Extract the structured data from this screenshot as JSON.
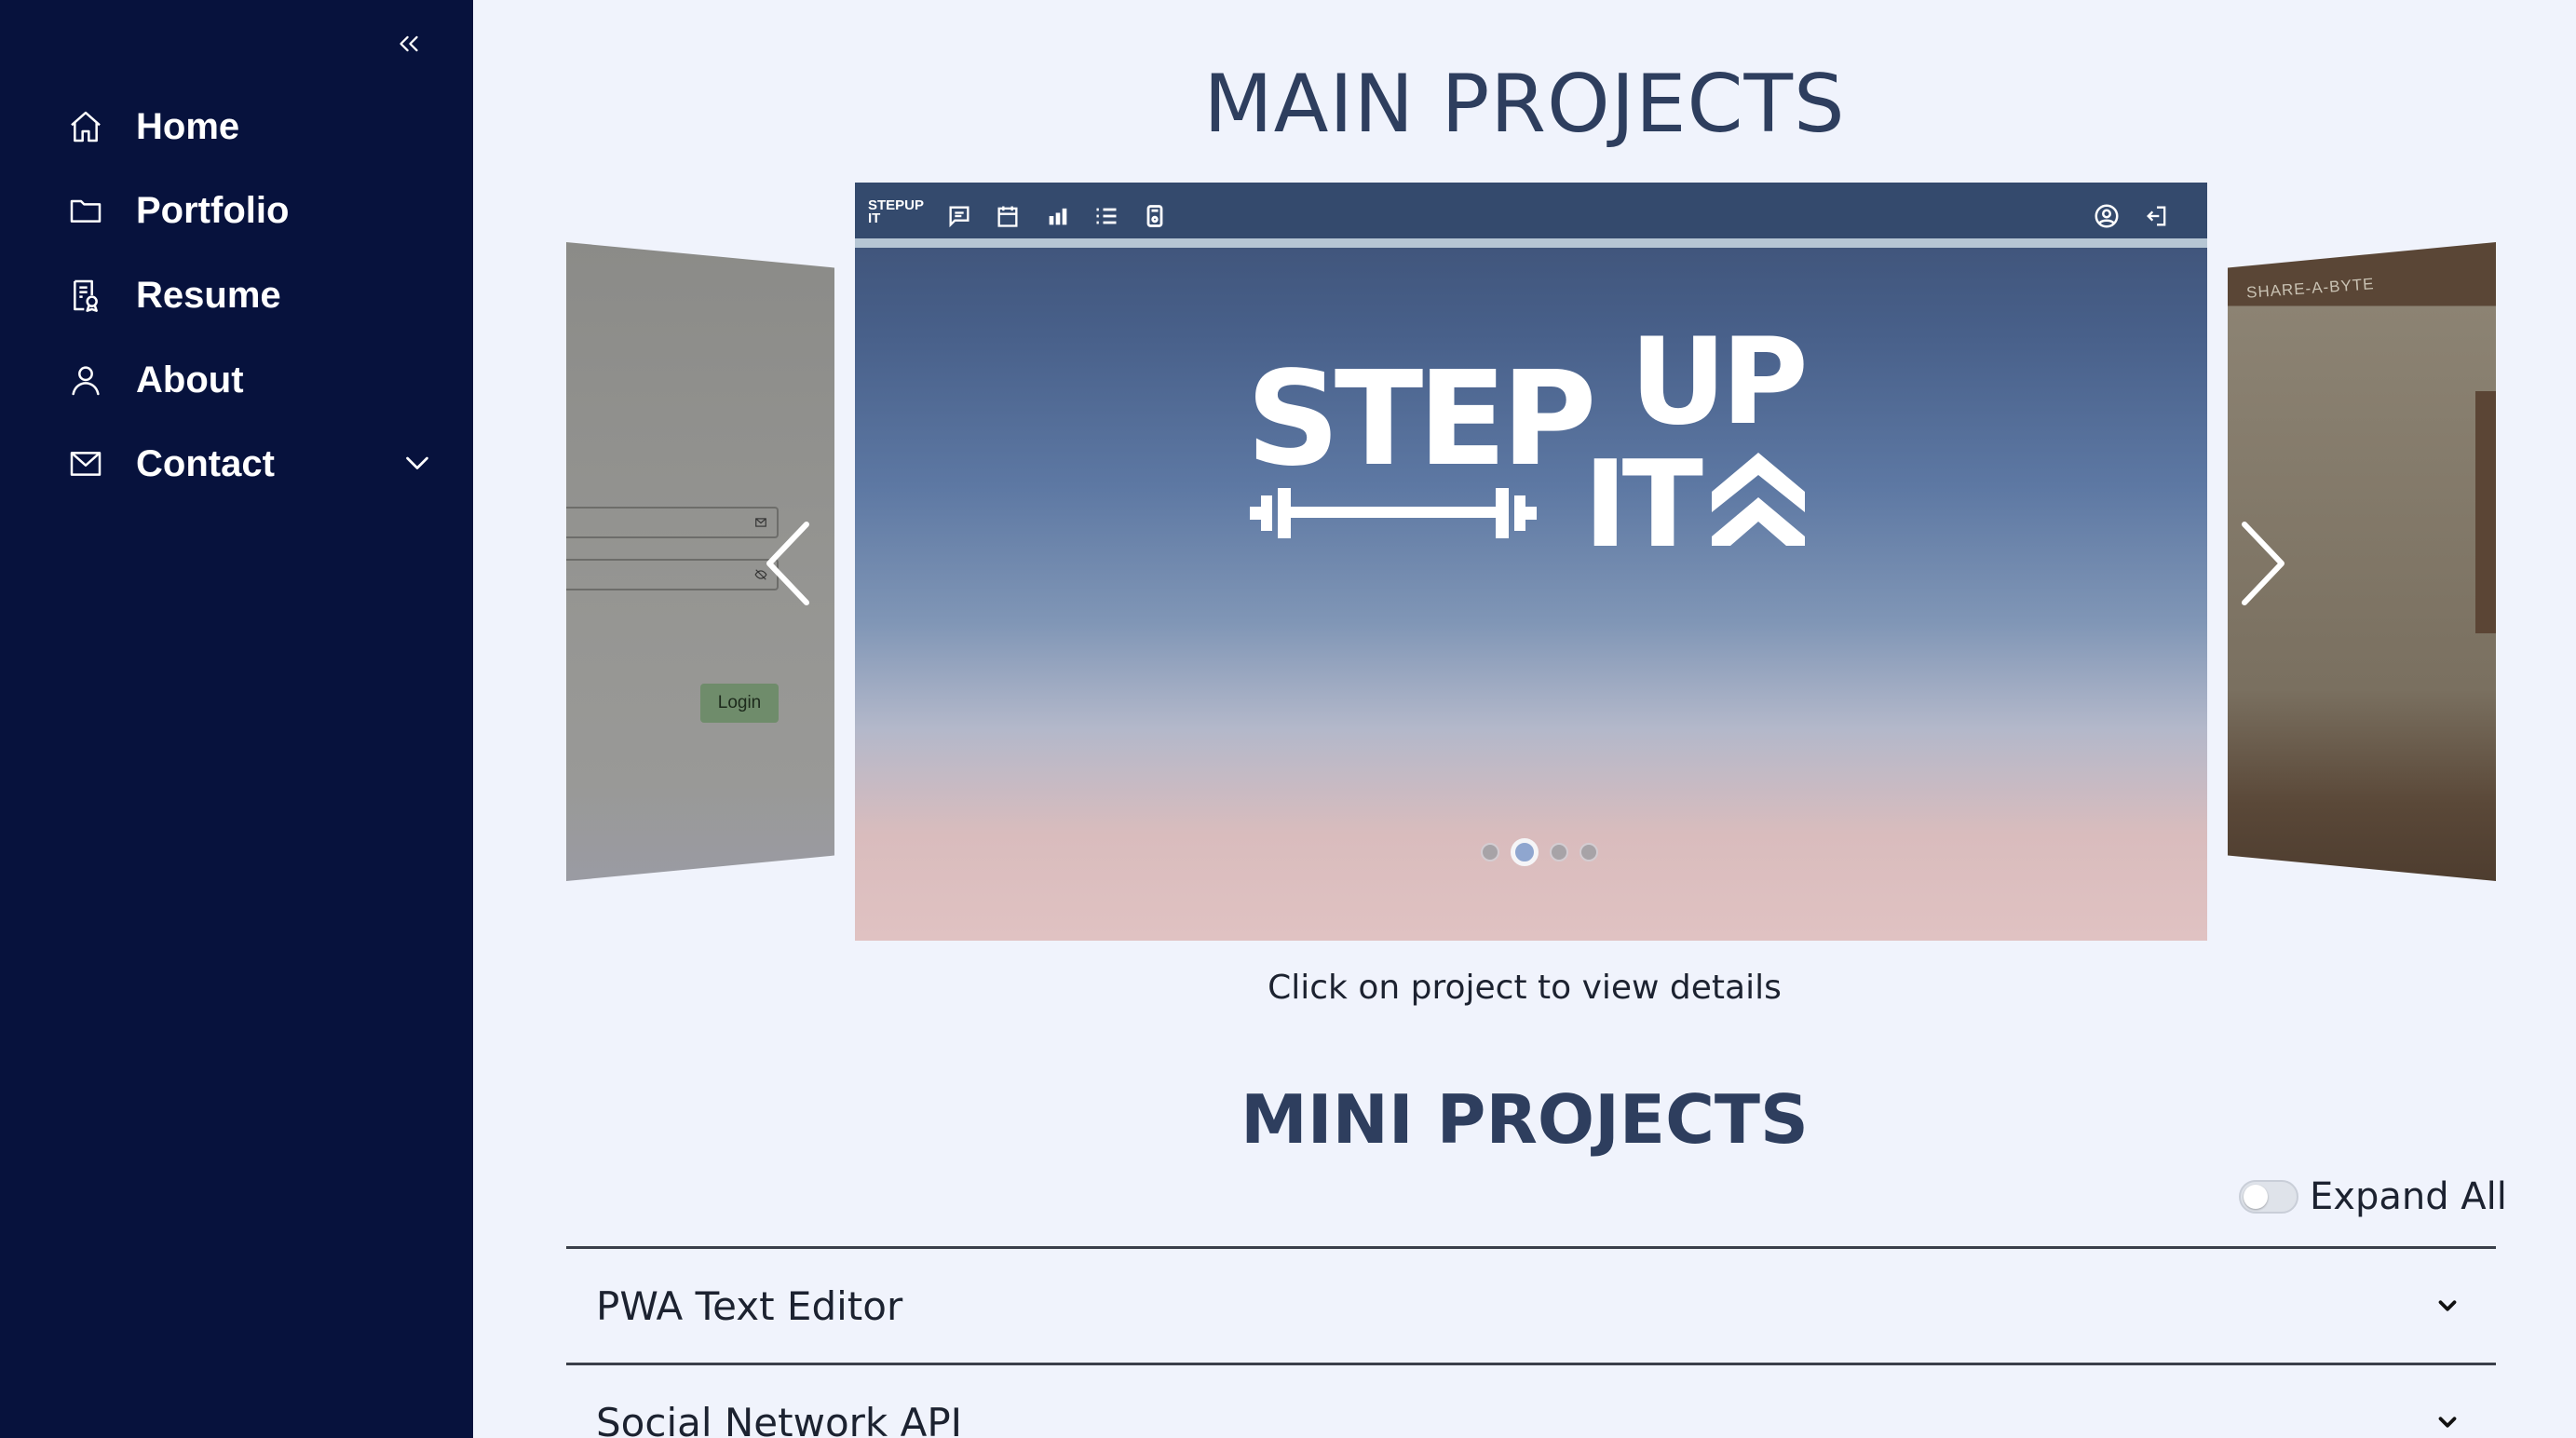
{
  "sidebar": {
    "collapse_icon": "double-chevron-left-icon",
    "items": [
      {
        "label": "Home",
        "icon": "home-icon"
      },
      {
        "label": "Portfolio",
        "icon": "folder-icon"
      },
      {
        "label": "Resume",
        "icon": "resume-icon"
      },
      {
        "label": "About",
        "icon": "user-icon"
      },
      {
        "label": "Contact",
        "icon": "mail-icon",
        "has_submenu": true
      }
    ],
    "background": "#07123d"
  },
  "main_projects": {
    "title": "MAIN PROJECTS",
    "caption": "Click on project to view details",
    "slides": {
      "left": {
        "login_button": "Login"
      },
      "center": {
        "logo_line1": "STEP",
        "logo_line2": "UP",
        "logo_line3": "IT",
        "topbar_logo": "STEPUP IT"
      },
      "right": {
        "brand": "SHARE-A-BYTE"
      }
    },
    "active_dot": 2,
    "dot_count": 4
  },
  "mini_projects": {
    "title": "MINI PROJECTS",
    "expand_all_label": "Expand All",
    "expand_all_on": false,
    "items": [
      {
        "label": "PWA Text Editor"
      },
      {
        "label": "Social Network API"
      }
    ]
  },
  "colors": {
    "page_bg": "#f0f3fc",
    "heading": "#2e3e5e",
    "topbar": "#344a6d"
  }
}
